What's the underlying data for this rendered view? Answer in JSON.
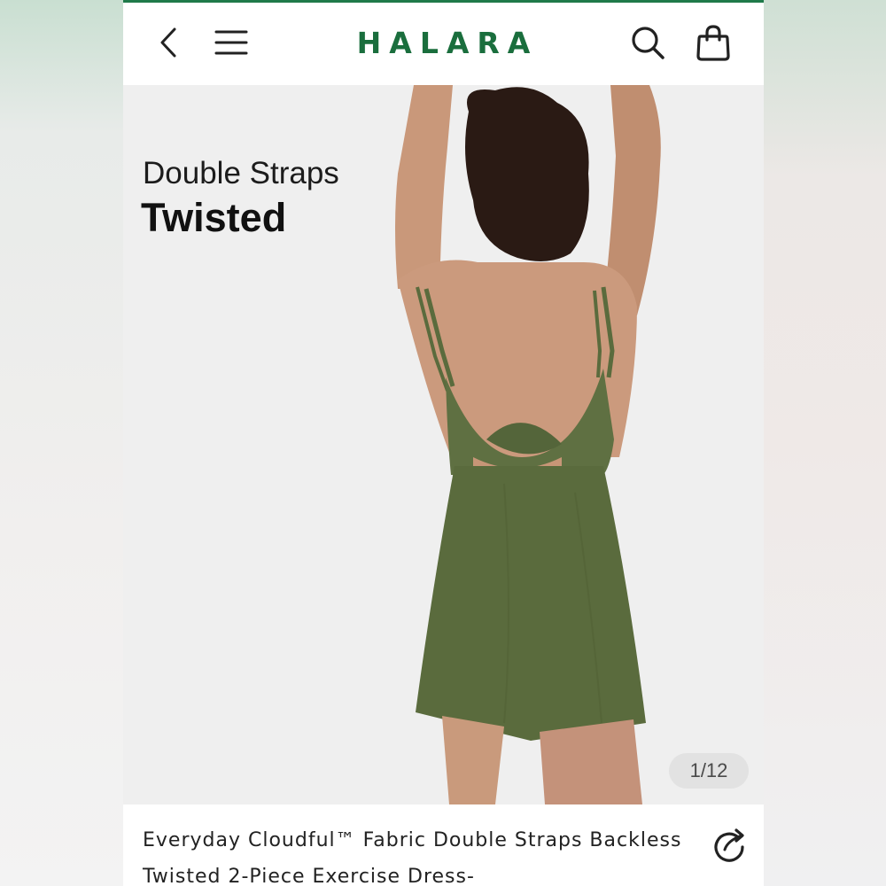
{
  "brand": {
    "logo": "HALARA",
    "accent_color": "#1a6e3d"
  },
  "header": {
    "icons": [
      "chevron-left-icon",
      "menu-icon",
      "search-icon",
      "shopping-bag-icon"
    ]
  },
  "hero": {
    "subtitle": "Double Straps",
    "title": "Twisted",
    "image_counter": "1/12",
    "dress_color": "#5a6b3d"
  },
  "product": {
    "title": "Everyday Cloudful™ Fabric Double Straps Backless Twisted 2-Piece Exercise Dress-",
    "share_icon": "share-icon"
  }
}
